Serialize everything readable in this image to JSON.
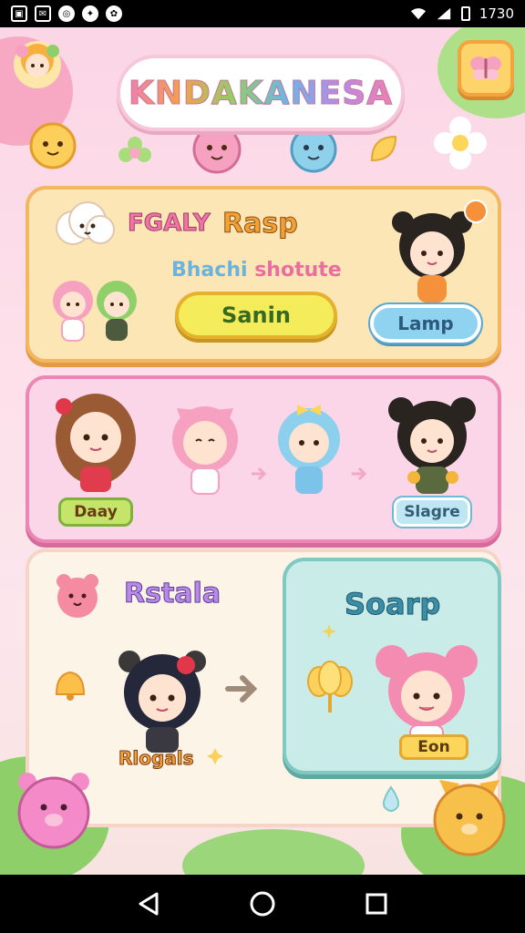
{
  "status_bar": {
    "time": "1730",
    "icons": [
      "image-icon",
      "mail-icon",
      "vpn-icon",
      "app-icon",
      "settings-icon",
      "wifi-icon",
      "signal-icon",
      "battery-icon"
    ]
  },
  "header": {
    "title": "KNDAKANESA",
    "corner_button_icon": "butterfly-icon",
    "avatar_icon": "chibi-avatar-icon"
  },
  "panel1": {
    "label_left": "FGALY",
    "label_right": "Rasp",
    "subtitle_a": "Bhachi",
    "subtitle_b": "shotute",
    "primary_button": "Sanin",
    "secondary_button": "Lamp"
  },
  "panel2": {
    "left_tag": "Daay",
    "right_tag": "Slagre"
  },
  "panel3": {
    "title": "Rstala",
    "character_tag": "Rlogals"
  },
  "panel4": {
    "title": "Soarp",
    "tag": "Eon"
  },
  "colors": {
    "background": "#f9d3e3",
    "panel_yellow": "#fde6b6",
    "panel_pink": "#fbd6e8",
    "panel_teal": "#c9ece9",
    "accent_orange": "#f3b661"
  },
  "nav_bar": {
    "icons": [
      "back-icon",
      "home-icon",
      "recents-icon"
    ]
  }
}
